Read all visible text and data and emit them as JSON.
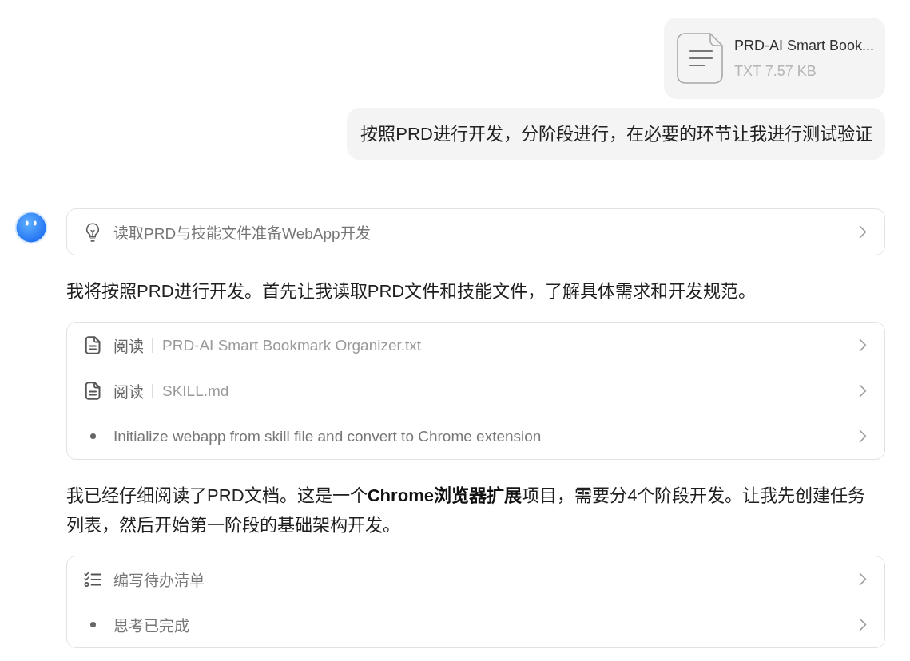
{
  "user_message": {
    "attachment": {
      "name": "PRD-AI Smart Book...",
      "meta": "TXT 7.57 KB"
    },
    "text": "按照PRD进行开发，分阶段进行，在必要的环节让我进行测试验证"
  },
  "assistant_message": {
    "blocks": [
      {
        "kind": "steps",
        "steps": [
          {
            "kind": "idea",
            "label": "读取PRD与技能文件准备WebApp开发"
          }
        ]
      },
      {
        "kind": "text",
        "text": "我将按照PRD进行开发。首先让我读取PRD文件和技能文件，了解具体需求和开发规范。"
      },
      {
        "kind": "steps",
        "steps": [
          {
            "kind": "read",
            "action": "阅读",
            "label": "PRD-AI Smart Bookmark Organizer.txt"
          },
          {
            "kind": "read",
            "action": "阅读",
            "label": "SKILL.md"
          },
          {
            "kind": "bullet",
            "label": "Initialize webapp from skill file and convert to Chrome extension"
          }
        ]
      },
      {
        "kind": "text",
        "text": "我已经仔细阅读了PRD文档。这是一个**Chrome浏览器扩展**项目，需要分4个阶段开发。让我先创建任务列表，然后开始第一阶段的基础架构开发。"
      },
      {
        "kind": "steps",
        "steps": [
          {
            "kind": "todo",
            "label": "编写待办清单"
          },
          {
            "kind": "bullet",
            "label": "思考已完成"
          }
        ]
      }
    ]
  }
}
